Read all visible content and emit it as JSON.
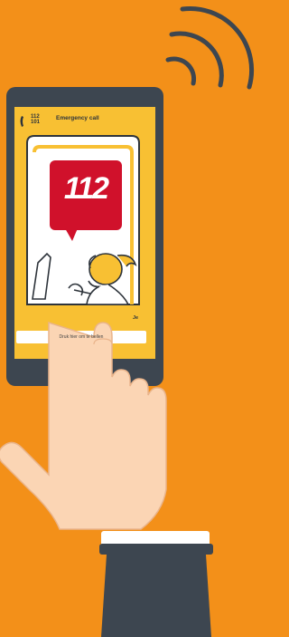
{
  "screen": {
    "header_title": "Emergency call",
    "logo_text": "112",
    "logo_subtext": "101",
    "emergency_number": "112",
    "response_label": "Je",
    "button_label": "Druk hier om te bellen"
  },
  "colors": {
    "background": "#F39019",
    "phone_body": "#3D4650",
    "screen_yellow": "#F8C033",
    "badge_red": "#D0112B",
    "hand_skin": "#FBD5B4"
  },
  "icons": [
    "phone-icon",
    "signal-waves-icon",
    "operator-illustration",
    "hand-pointer-icon"
  ]
}
